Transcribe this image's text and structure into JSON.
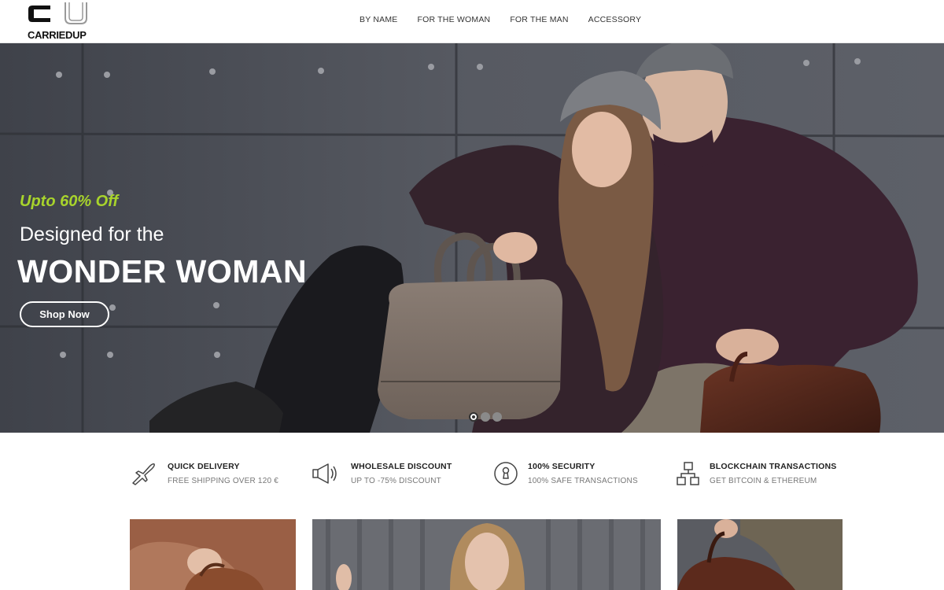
{
  "brand": {
    "name": "CARRIEDUP"
  },
  "nav": {
    "items": [
      "BY NAME",
      "FOR THE WOMAN",
      "FOR THE MAN",
      "ACCESSORY"
    ]
  },
  "hero": {
    "promo": "Upto 60% Off",
    "subtitle": "Designed for the",
    "headline": "WONDER WOMAN",
    "cta": "Shop Now",
    "slide_count": 3,
    "active_slide": 1,
    "accent_color": "#a8d42c"
  },
  "features": [
    {
      "icon": "plane-icon",
      "title": "QUICK DELIVERY",
      "subtitle": "FREE SHIPPING OVER 120 €"
    },
    {
      "icon": "megaphone-icon",
      "title": "WHOLESALE DISCOUNT",
      "subtitle": "UP TO -75% DISCOUNT"
    },
    {
      "icon": "keyhole-icon",
      "title": "100% SECURITY",
      "subtitle": "100% SAFE TRANSACTIONS"
    },
    {
      "icon": "blocks-icon",
      "title": "BLOCKCHAIN TRANSACTIONS",
      "subtitle": "GET BITCOIN & ETHEREUM"
    }
  ]
}
